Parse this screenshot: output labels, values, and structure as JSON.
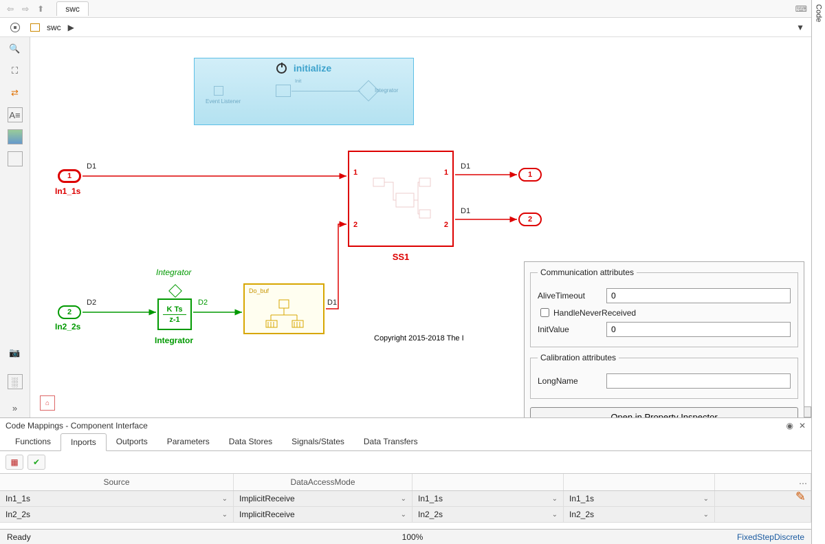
{
  "topnav": {
    "tab_label": "swc"
  },
  "breadcrumb": {
    "model": "swc",
    "play": "▶"
  },
  "codetab": {
    "label": "Code"
  },
  "init": {
    "title": "initialize",
    "ev_listener": "Event Listener",
    "integrator": "Integrator",
    "init": "Init"
  },
  "ports": {
    "in1_num": "1",
    "in1_name": "In1_1s",
    "in1_sig": "D1",
    "in2_num": "2",
    "in2_name": "In2_2s",
    "in2_sig": "D2",
    "out1_num": "1",
    "out2_num": "2",
    "ss_d1_a": "D1",
    "ss_d1_b": "D1",
    "ss_p1": "1",
    "ss_p2": "2"
  },
  "integrator": {
    "kts": "K Ts",
    "zm1": "z-1",
    "name": "Integrator",
    "italic": "Integrator",
    "sig": "D2"
  },
  "dsb": {
    "label": "Do_buf",
    "sig": "D1"
  },
  "ss": {
    "title": "SS1"
  },
  "copyright": "Copyright 2015-2018 The I",
  "popup": {
    "group1": "Communication attributes",
    "alive_label": "AliveTimeout",
    "alive_val": "0",
    "hnr_label": "HandleNeverReceived",
    "init_label": "InitValue",
    "init_val": "0",
    "group2": "Calibration attributes",
    "long_label": "LongName",
    "long_val": "",
    "button": "Open in Property Inspector"
  },
  "mappings": {
    "title": "Code Mappings - Component Interface",
    "tabs": {
      "functions": "Functions",
      "inports": "Inports",
      "outports": "Outports",
      "parameters": "Parameters",
      "datastores": "Data Stores",
      "signals": "Signals/States",
      "transfers": "Data Transfers"
    },
    "cols": {
      "source": "Source",
      "dam": "DataAccessMode",
      "c3": "",
      "c4": ""
    },
    "rows": [
      {
        "source": "In1_1s",
        "dam": "ImplicitReceive",
        "c3": "In1_1s",
        "c4": "In1_1s"
      },
      {
        "source": "In2_2s",
        "dam": "ImplicitReceive",
        "c3": "In2_2s",
        "c4": "In2_2s"
      }
    ]
  },
  "status": {
    "ready": "Ready",
    "zoom": "100%",
    "solver": "FixedStepDiscrete"
  }
}
